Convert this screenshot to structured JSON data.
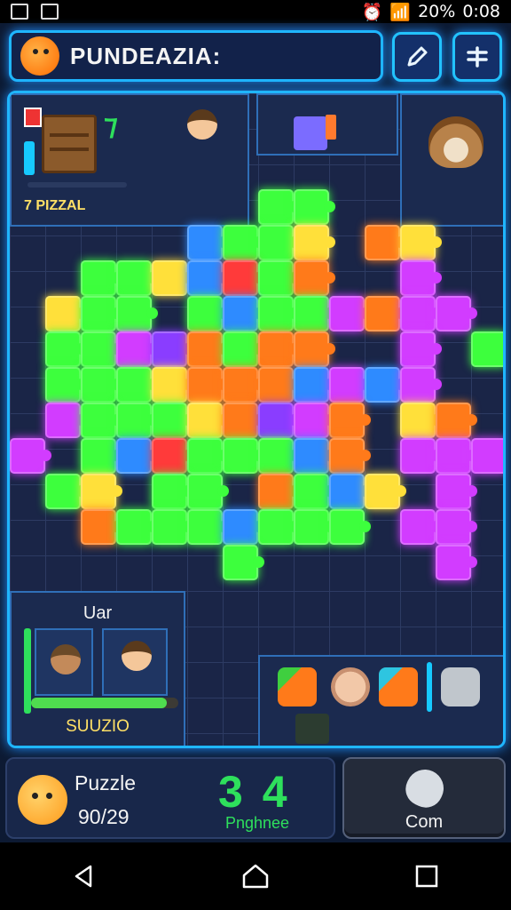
{
  "status_bar": {
    "battery": "20%",
    "time": "0:08"
  },
  "header": {
    "title": "PUNDEAZIA:"
  },
  "top_left_panel": {
    "label": "7 PIZZAL"
  },
  "bottom_left_panel": {
    "title": "Uar",
    "label": "SUUZIO",
    "progress": 0.92
  },
  "bottom_bar": {
    "card_title": "Puzzle",
    "card_count": "90/29",
    "score": "3 4",
    "score_label": "Pnghnee",
    "com_button_label": "Com"
  },
  "colors": {
    "accent": "#1fb6ff",
    "score": "#2ee05c",
    "frame_bg": "#1a2547"
  },
  "icons": [
    "gallery-icon",
    "image-icon",
    "alarm-icon",
    "wifi-icon",
    "signal-icon",
    "pencil-icon",
    "menu-icon",
    "back-icon",
    "home-icon",
    "recents-icon"
  ]
}
